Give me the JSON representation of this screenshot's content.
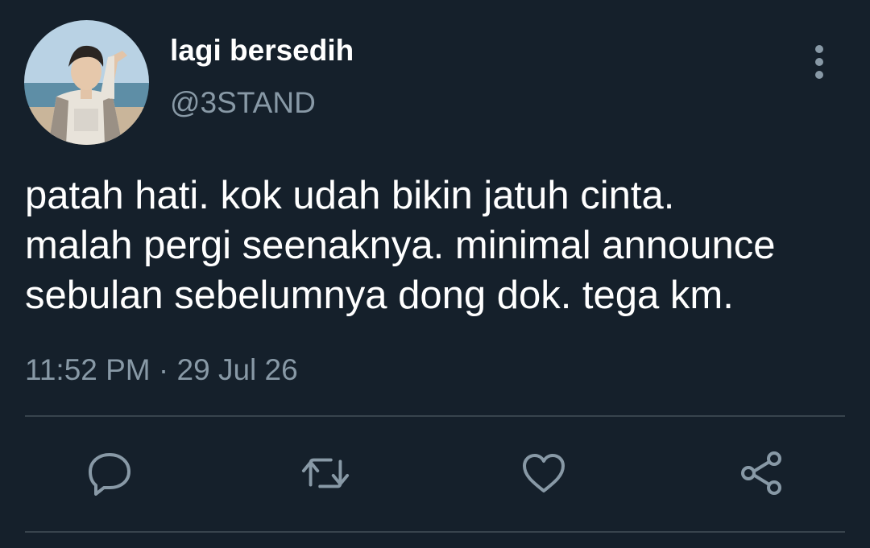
{
  "tweet": {
    "display_name": "lagi bersedih",
    "handle": "@3STAND",
    "text_lines": [
      "patah hati. kok udah bikin jatuh cinta.",
      "malah pergi seenaknya. minimal announce",
      "sebulan sebelumnya dong dok. tega km."
    ],
    "time": "11:52 PM",
    "separator": "·",
    "date": "29 Jul 26"
  },
  "icons": {
    "more": "vertical-ellipsis-icon",
    "reply": "speech-bubble-icon",
    "retweet": "retweet-arrows-icon",
    "like": "heart-icon",
    "share": "share-nodes-icon"
  },
  "colors": {
    "background": "#15202b",
    "primary_text": "#ffffff",
    "secondary_text": "#8899a6",
    "divider": "#38444d"
  }
}
